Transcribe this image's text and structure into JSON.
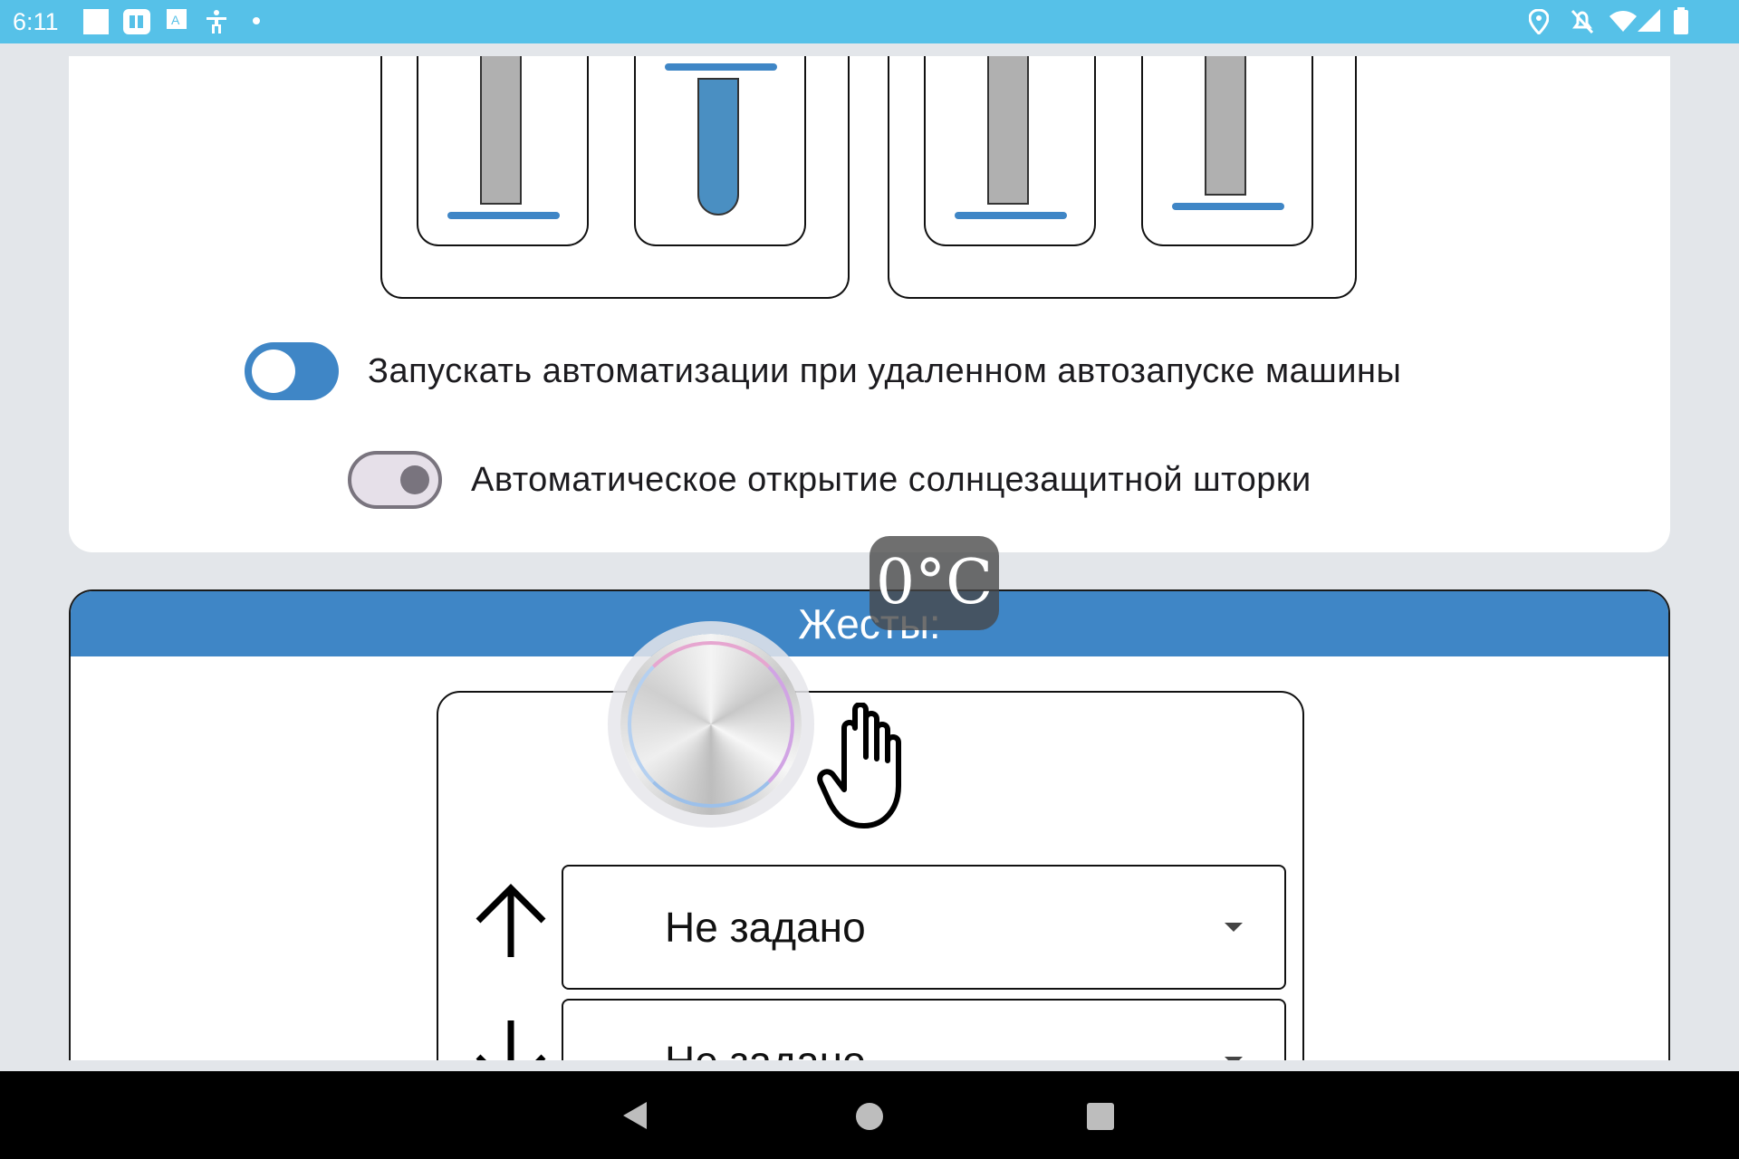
{
  "status_bar": {
    "time": "6:11",
    "icons": [
      "notification-square-icon",
      "app-icon",
      "translate-icon",
      "accessibility-icon",
      "dot-icon",
      "location-icon",
      "alarm-off-icon",
      "wifi-icon",
      "signal-icon",
      "battery-icon"
    ]
  },
  "settings": {
    "toggles": [
      {
        "label": "Запускать автоматизации при удаленном автозапуске машины",
        "state": "on"
      },
      {
        "label": "Автоматическое открытие солнцезащитной шторки",
        "state": "off"
      }
    ]
  },
  "gestures": {
    "header": "Жесты:",
    "rows": [
      {
        "direction_icon": "arrow-up-icon",
        "value": "Не задано"
      },
      {
        "direction_icon": "arrow-down-icon",
        "value": "Не задано"
      }
    ]
  },
  "overlays": {
    "temperature": "0°C"
  },
  "colors": {
    "accent": "#3f86c6",
    "status_bar": "#56c1e8",
    "toggle_off": "#79747e"
  },
  "nav_bar": {
    "buttons": [
      "back-icon",
      "home-icon",
      "recents-icon"
    ]
  }
}
